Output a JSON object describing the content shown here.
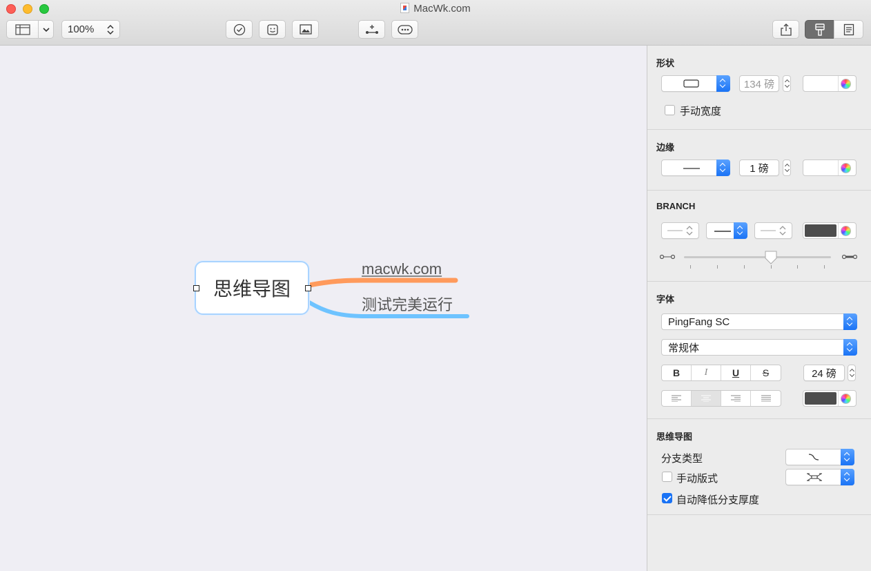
{
  "window": {
    "title": "MacWk.com"
  },
  "toolbar": {
    "zoom_value": "100%",
    "buttons": [
      "sidebar-toggle",
      "sidebar-dropdown",
      "task",
      "sticker",
      "image",
      "add-topic",
      "more",
      "share",
      "format",
      "notes"
    ]
  },
  "canvas": {
    "central_topic": "思维导图",
    "subtopics": [
      {
        "label": "macwk.com",
        "branch_color": "#ff9a5c"
      },
      {
        "label": "测试完美运行",
        "branch_color": "#6ec3ff"
      }
    ],
    "topic_border_color": "#a9d3ff",
    "background_color": "#efeef4"
  },
  "inspector": {
    "shape": {
      "title": "形状",
      "width_value": "134 磅",
      "manual_width_label": "手动宽度",
      "manual_width_checked": false,
      "fill_color": "#ffffff"
    },
    "border": {
      "title": "边缘",
      "width_value": "1 磅",
      "color": "#ffffff"
    },
    "branch": {
      "title": "BRANCH",
      "color": "#4d4d4d",
      "thickness_level": 0.63
    },
    "font": {
      "title": "字体",
      "family": "PingFang SC",
      "style": "常规体",
      "bold": "B",
      "italic": "I",
      "underline": "U",
      "strike": "S",
      "size_value": "24 磅",
      "alignment": "center",
      "color": "#4d4d4d"
    },
    "mindmap": {
      "title": "思维导图",
      "branch_type_label": "分支类型",
      "manual_layout_label": "手动版式",
      "manual_layout_checked": false,
      "auto_reduce_label": "自动降低分支厚度",
      "auto_reduce_checked": true
    }
  },
  "colors": {
    "accent": "#1a73f5"
  }
}
